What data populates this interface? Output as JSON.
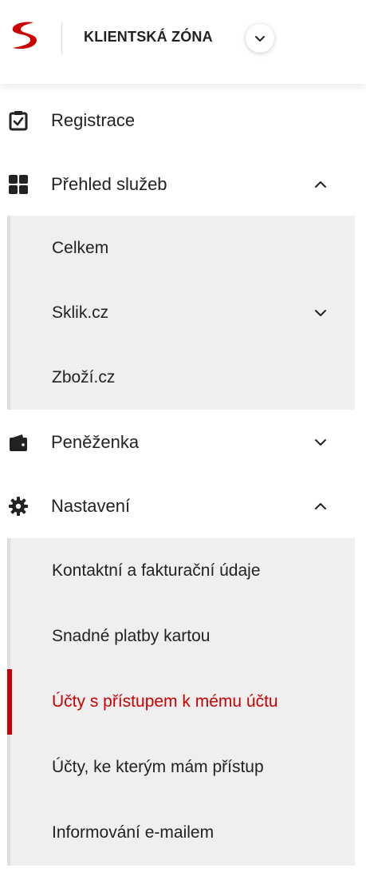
{
  "header": {
    "title": "KLIENTSKÁ ZÓNA",
    "logo_icon": "seznam-s-logo",
    "switch_icon": "chevron-down-icon",
    "brand_color": "#cc0000"
  },
  "nav": {
    "items": [
      {
        "label": "Registrace",
        "icon": "clipboard-check-icon"
      },
      {
        "label": "Přehled služeb",
        "icon": "grid-icon",
        "expanded": true,
        "children": [
          {
            "label": "Celkem"
          },
          {
            "label": "Sklik.cz",
            "has_chevron": true
          },
          {
            "label": "Zboží.cz"
          }
        ]
      },
      {
        "label": "Peněženka",
        "icon": "wallet-icon",
        "expanded": false
      },
      {
        "label": "Nastavení",
        "icon": "gear-icon",
        "expanded": true,
        "children": [
          {
            "label": "Kontaktní a fakturační údaje"
          },
          {
            "label": "Snadné platby kartou"
          },
          {
            "label": "Účty s přístupem k mému účtu",
            "active": true
          },
          {
            "label": "Účty, ke kterým mám přístup"
          },
          {
            "label": "Informování e-mailem"
          }
        ]
      }
    ]
  },
  "colors": {
    "active": "#cc0000",
    "submenu_bg": "#efefef",
    "text": "#222222"
  }
}
